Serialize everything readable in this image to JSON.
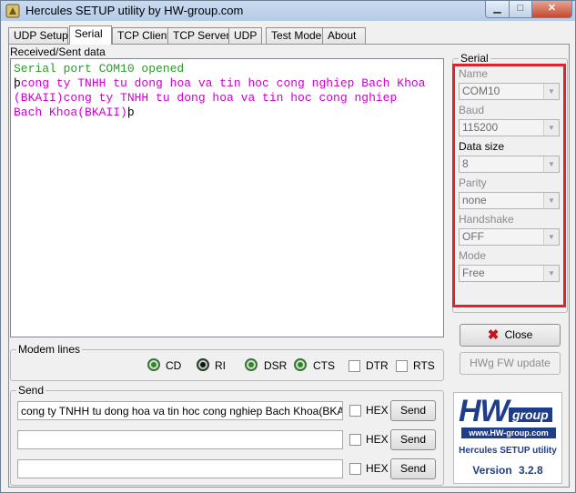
{
  "window": {
    "title": "Hercules SETUP utility by HW-group.com",
    "controls": {
      "minimize": "▁",
      "maximize": "□",
      "close": "✕"
    }
  },
  "tabs": [
    "UDP Setup",
    "Serial",
    "TCP Client",
    "TCP Server",
    "UDP",
    "Test Mode",
    "About"
  ],
  "active_tab": "Serial",
  "received": {
    "label": "Received/Sent data",
    "line1": "Serial port COM10 opened",
    "cursor_char": "þ",
    "line2": "cong ty TNHH tu dong hoa va tin hoc cong nghiep Bach Khoa",
    "line3": "(BKAII)cong ty TNHH tu dong hoa va tin hoc cong nghiep",
    "line4": "Bach Khoa(BKAII)"
  },
  "serial": {
    "group_label": "Serial",
    "name_label": "Name",
    "name_value": "COM10",
    "baud_label": "Baud",
    "baud_value": "115200",
    "datasize_label": "Data size",
    "datasize_value": "8",
    "parity_label": "Parity",
    "parity_value": "none",
    "handshake_label": "Handshake",
    "handshake_value": "OFF",
    "mode_label": "Mode",
    "mode_value": "Free"
  },
  "buttons": {
    "close": "Close",
    "fw_update": "HWg FW update"
  },
  "modem": {
    "label": "Modem lines",
    "cd": "CD",
    "ri": "RI",
    "dsr": "DSR",
    "cts": "CTS",
    "dtr": "DTR",
    "rts": "RTS"
  },
  "send": {
    "label": "Send",
    "rows": [
      {
        "value": "cong ty TNHH tu dong hoa va tin hoc cong nghiep Bach Khoa(BKAII)",
        "hex": "HEX",
        "button": "Send"
      },
      {
        "value": "",
        "hex": "HEX",
        "button": "Send"
      },
      {
        "value": "",
        "hex": "HEX",
        "button": "Send"
      }
    ]
  },
  "logo": {
    "brand": "HW",
    "brand_suffix": "group",
    "url": "www.HW-group.com",
    "product": "Hercules SETUP utility",
    "version_label": "Version",
    "version": "3.2.8"
  },
  "colors": {
    "accent_red": "#e0232b",
    "text_green": "#2b9a2b",
    "text_pink": "#d000d0",
    "logo_blue": "#1e3d8a"
  }
}
